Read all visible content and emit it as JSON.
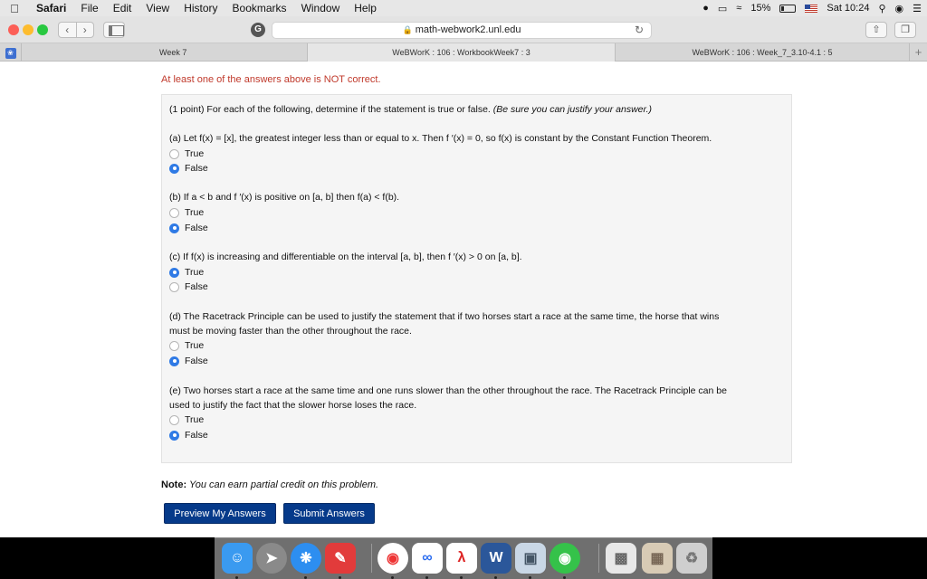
{
  "menubar": {
    "app_name": "Safari",
    "menus": [
      "File",
      "Edit",
      "View",
      "History",
      "Bookmarks",
      "Window",
      "Help"
    ],
    "battery": "15%",
    "clock": "Sat 10:24"
  },
  "toolbar": {
    "url": "math-webwork2.unl.edu",
    "extension_letter": "G"
  },
  "tabs": {
    "tab1": "Week 7",
    "tab2": "WeBWorK : 106 : WorkbookWeek7 : 3",
    "tab3": "WeBWorK : 106 : Week_7_3.10-4.1 : 5",
    "add": "+"
  },
  "page": {
    "alert": "At least one of the answers above is NOT correct.",
    "intro_prefix": "(1 point) For each of the following, determine if the statement is true or false. ",
    "intro_italic": "(Be sure you can justify your answer.)",
    "questions": [
      {
        "text": "(a) Let f(x) = [x], the greatest integer less than or equal to x. Then f ′(x) = 0, so f(x) is constant by the Constant Function Theorem.",
        "options": [
          "True",
          "False"
        ],
        "selected": "False"
      },
      {
        "text": "(b) If a < b and f ′(x) is positive on [a, b] then f(a) < f(b).",
        "options": [
          "True",
          "False"
        ],
        "selected": "False"
      },
      {
        "text": "(c) If f(x) is increasing and differentiable on the interval [a, b], then f ′(x) > 0 on [a, b].",
        "options": [
          "True",
          "False"
        ],
        "selected": "True"
      },
      {
        "text_line1": "(d) The Racetrack Principle can be used to justify the statement that if two horses start a race at the same time, the horse that wins",
        "text_line2": "must be moving faster than the other throughout the race.",
        "options": [
          "True",
          "False"
        ],
        "selected": "False"
      },
      {
        "text_line1": "(e) Two horses start a race at the same time and one runs slower than the other throughout the race. The Racetrack Principle can be",
        "text_line2": "used to justify the fact that the slower horse loses the race.",
        "options": [
          "True",
          "False"
        ],
        "selected": "False"
      }
    ],
    "note_label": "Note:",
    "note_text": " You can earn partial credit on this problem.",
    "preview_button": "Preview My Answers",
    "submit_button": "Submit Answers"
  },
  "dock": {
    "icons": [
      "finder-icon",
      "launchpad-icon",
      "safari-icon",
      "pdf-pen-icon",
      "chrome-icon",
      "baidu-netdisk-icon",
      "acrobat-icon",
      "word-icon",
      "preview-icon",
      "wechat-icon",
      "screenshot-icon",
      "archive-icon",
      "trash-icon"
    ]
  }
}
